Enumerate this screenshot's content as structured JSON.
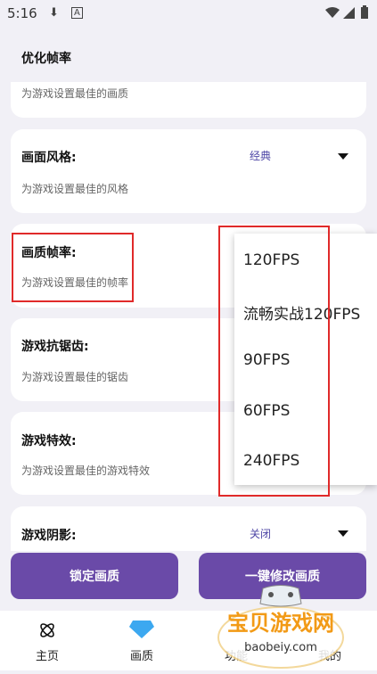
{
  "status": {
    "time": "5:16"
  },
  "header": {
    "title": "优化帧率"
  },
  "cards": [
    {
      "desc": "为游戏设置最佳的画质"
    },
    {
      "title": "画面风格:",
      "value": "经典",
      "desc": "为游戏设置最佳的风格"
    },
    {
      "title": "画质帧率:",
      "desc": "为游戏设置最佳的帧率"
    },
    {
      "title": "游戏抗锯齿:",
      "desc": "为游戏设置最佳的锯齿"
    },
    {
      "title": "游戏特效:",
      "desc": "为游戏设置最佳的游戏特效"
    },
    {
      "title": "游戏阴影:",
      "value": "关闭"
    }
  ],
  "dropdown": {
    "options": [
      "120FPS",
      "流畅实战120FPS",
      "90FPS",
      "60FPS",
      "240FPS"
    ]
  },
  "buttons": {
    "lock": "锁定画质",
    "modify": "一键修改画质"
  },
  "nav": {
    "home": "主页",
    "quality": "画质",
    "functions": "功能",
    "mine": "我的"
  },
  "watermark": {
    "brand": "宝贝游戏网",
    "url": "baobeiy.com"
  },
  "colors": {
    "accent": "#6a4aa8",
    "highlight": "#e02a2a",
    "value_text": "#4f47a6"
  }
}
